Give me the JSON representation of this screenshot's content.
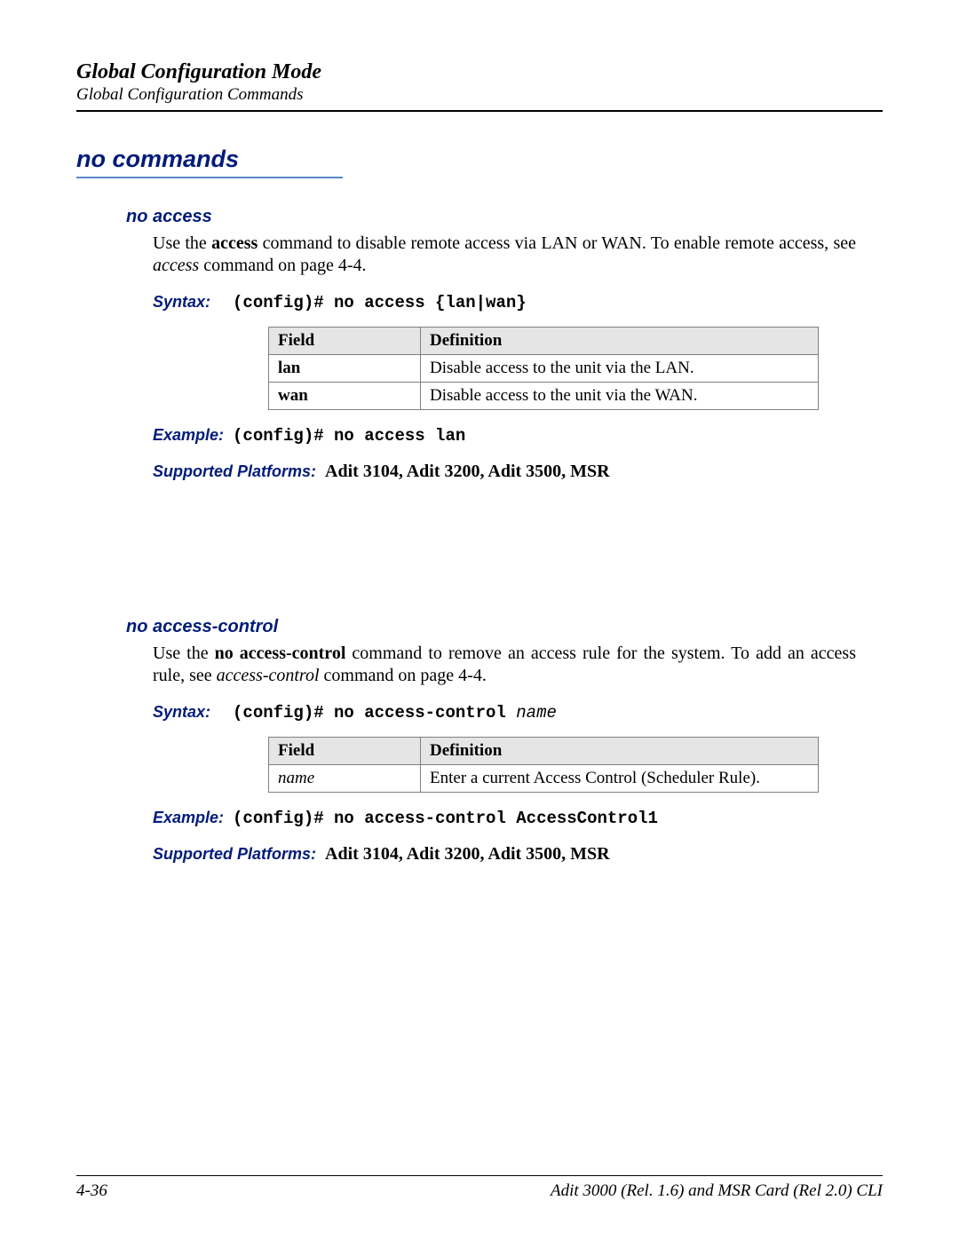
{
  "header": {
    "title": "Global Configuration Mode",
    "subtitle": "Global Configuration Commands"
  },
  "main_heading": "no commands",
  "sections": [
    {
      "heading": "no access",
      "intro_pre": "Use the ",
      "intro_cmd": "access",
      "intro_post": " command to disable remote access via LAN or WAN. To enable remote access, see ",
      "intro_ref_i": "access",
      "intro_ref_tail": " command on page 4-4.",
      "syntax_label": "Syntax:",
      "syntax_cmd": "(config)# no access {lan|wan}",
      "table": {
        "col_field": "Field",
        "col_def": "Definition",
        "rows": [
          {
            "field": "lan",
            "field_style": "b",
            "def": "Disable access to the unit via the LAN."
          },
          {
            "field": "wan",
            "field_style": "b",
            "def": "Disable access to the unit via the WAN."
          }
        ]
      },
      "example_label": "Example:",
      "example_cmd": "(config)# no access lan",
      "platforms_label": "Supported Platforms:",
      "platforms_val": "Adit 3104, Adit 3200, Adit 3500, MSR"
    },
    {
      "heading": "no access-control",
      "intro_pre": "Use the ",
      "intro_cmd": "no access-control",
      "intro_post": " command to remove an access rule for the system. To add an access rule, see ",
      "intro_ref_i": "access-control",
      "intro_ref_tail": " command on page 4-4.",
      "syntax_label": "Syntax:",
      "syntax_cmd": "(config)# no access-control ",
      "syntax_arg": "name",
      "table": {
        "col_field": "Field",
        "col_def": "Definition",
        "rows": [
          {
            "field": "name",
            "field_style": "i",
            "def": "Enter a current Access Control (Scheduler Rule)."
          }
        ]
      },
      "example_label": "Example:",
      "example_cmd": "(config)# no access-control AccessControl1",
      "platforms_label": "Supported Platforms:",
      "platforms_val": "Adit 3104, Adit 3200, Adit 3500, MSR"
    }
  ],
  "footer": {
    "left": "4-36",
    "right": "Adit 3000 (Rel. 1.6) and MSR Card (Rel 2.0) CLI"
  }
}
